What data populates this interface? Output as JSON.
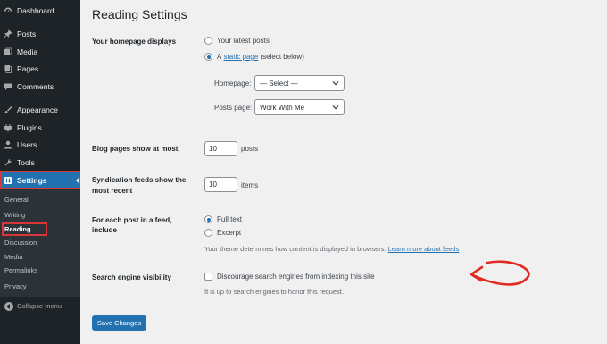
{
  "sidebar": {
    "items": [
      {
        "label": "Dashboard",
        "icon": "dashboard-icon"
      },
      {
        "label": "Posts",
        "icon": "pin-icon"
      },
      {
        "label": "Media",
        "icon": "media-icon"
      },
      {
        "label": "Pages",
        "icon": "pages-icon"
      },
      {
        "label": "Comments",
        "icon": "comment-icon"
      },
      {
        "label": "Appearance",
        "icon": "brush-icon"
      },
      {
        "label": "Plugins",
        "icon": "plugin-icon"
      },
      {
        "label": "Users",
        "icon": "user-icon"
      },
      {
        "label": "Tools",
        "icon": "wrench-icon"
      },
      {
        "label": "Settings",
        "icon": "settings-icon"
      }
    ],
    "submenu": [
      "General",
      "Writing",
      "Reading",
      "Discussion",
      "Media",
      "Permalinks",
      "Privacy"
    ],
    "collapse_label": "Collapse menu"
  },
  "page": {
    "title": "Reading Settings",
    "homepage": {
      "label": "Your homepage displays",
      "option_latest": "Your latest posts",
      "option_static_prefix": "A",
      "option_static_link": "static page",
      "option_static_suffix": "(select below)",
      "selected": "static page",
      "homepage_label": "Homepage:",
      "homepage_value": "— Select —",
      "postspage_label": "Posts page:",
      "postspage_value": "Work With Me"
    },
    "blog_pages": {
      "label": "Blog pages show at most",
      "value": "10",
      "suffix": "posts"
    },
    "syndication": {
      "label_line1": "Syndication feeds show the",
      "label_line2": "most recent",
      "value": "10",
      "suffix": "items"
    },
    "feed": {
      "label_line1": "For each post in a feed,",
      "label_line2": "include",
      "option_full": "Full text",
      "option_excerpt": "Excerpt",
      "selected": "Full text",
      "note": "Your theme determines how content is displayed in browsers.",
      "note_link": "Learn more about feeds"
    },
    "search": {
      "label": "Search engine visibility",
      "checkbox_label": "Discourage search engines from indexing this site",
      "checked": false,
      "note": "It is up to search engines to honor this request."
    },
    "save_label": "Save Changes"
  },
  "colors": {
    "accent": "#2271b1",
    "sidebar": "#1d2327",
    "highlight": "#d63638"
  }
}
